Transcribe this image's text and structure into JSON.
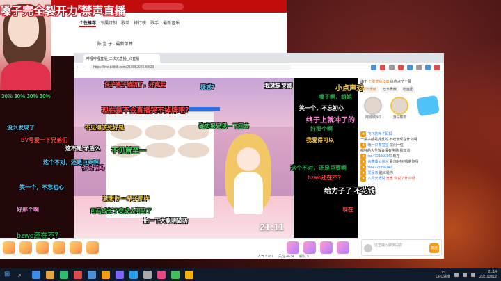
{
  "stream_title": "嗓子完全裂开力 禁声直播",
  "music": {
    "brand": "网易云音乐",
    "tabs": [
      "个性推荐",
      "专属订制",
      "歌单",
      "排行榜",
      "歌手",
      "最新音乐"
    ],
    "active_tab_index": 0,
    "sub": "陈 壹 子  · 最新单曲"
  },
  "browser": {
    "tab_title": "哔哩哔哩直播_二次元直播_h5直播",
    "url": "https://live.bilibili.com/21005297546523"
  },
  "game": {
    "clock": "21:11"
  },
  "chat": {
    "header_prefix": "由于",
    "header_user": "王冕梦的和田",
    "header_suffix": "给你点了个赞",
    "tabs": [
      "今日贡献",
      "七日贡献",
      "粉丝团"
    ],
    "active_tab_index": 0,
    "rank_names": [
      "阿城城NO",
      "游马楼奈"
    ],
    "messages": [
      {
        "user": "飞飞的叶子妈妈",
        "text": "",
        "red": false
      },
      {
        "user": "",
        "text": "一桌子都是反反的 不吃饭现在什么啊",
        "red": false
      },
      {
        "user": "瞌一只熊宝宝",
        "text": "提问一位",
        "red": false
      },
      {
        "user": "",
        "text": "嗯好的大生饭会没有电脑 我知道",
        "red": false
      },
      {
        "user": "tan4721956140",
        "text": "现在",
        "red": false
      },
      {
        "user": "余亮桑公亲大",
        "text": "看你好好 嗯嗯你吗",
        "red": false
      },
      {
        "user": "tan4721956140",
        "text": "",
        "red": false
      },
      {
        "user": "爱民亲",
        "text": "瞌三是你",
        "red": false
      },
      {
        "user": "八月大概说",
        "text": "宽宽 你说了什么呀",
        "red": true
      }
    ],
    "input_placeholder": "这里输入聊天内容",
    "send_label": "发送"
  },
  "gift_bar": {
    "stats": [
      "人气 5781",
      "关注 4634",
      "舰队 5"
    ]
  },
  "danmaku": [
    "保护嗓子破防了，好疼爱",
    "我就是哭卿",
    "小点声对",
    "30%  30%  30%  30%",
    "疑惑？",
    "我被宠亏了的",
    "嗓子啊，姐姐",
    "现在是不会直播哭不掉牌吧？",
    "笑一个，不忘初心",
    "不见得该死好是",
    "确实猴兄我一下回去",
    "没么发现了",
    "终于上就冲了的",
    "好那个啊",
    "BV号爱一下兄弟们",
    "这不是 矛盾么",
    "我爱得可以",
    "不见就至一",
    "这个不对，还是巨要啊",
    "你说话吗",
    "这个不对，还是巨要啊",
    "bzwc还在不？",
    "给力子了 不花钱",
    "就想你 一辈子那样",
    "可马成长了变成大河马了",
    "笑一个，不忘初心",
    "好那个啊",
    "bzwc还在不？",
    "现在",
    "拍一下大聪明破防"
  ],
  "taskbar": {
    "weather_temp": "11°C",
    "weather_label": "CPU温度",
    "time": "21:14",
    "date": "2021/10/12"
  },
  "colors": {
    "netease_red": "#c20c0c",
    "bilibili_orange": "#f39c12",
    "danmaku_palette": [
      "#ff4a4a",
      "#ffffff",
      "#ffd23f",
      "#4cd964",
      "#5ac8fa",
      "#ff8ad8",
      "#2fa84f"
    ]
  }
}
